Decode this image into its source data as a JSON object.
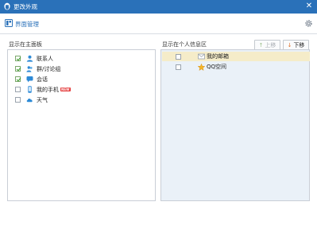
{
  "window": {
    "title": "更改外观",
    "close_glyph": "✕"
  },
  "toolbar": {
    "label": "界面管理"
  },
  "left": {
    "heading": "显示在主面板",
    "items": [
      {
        "label": "联系人",
        "checked": true,
        "icon": "contact-icon"
      },
      {
        "label": "群/讨论组",
        "checked": true,
        "icon": "group-icon"
      },
      {
        "label": "会话",
        "checked": true,
        "icon": "chat-icon"
      },
      {
        "label": "我的手机",
        "checked": false,
        "icon": "phone-icon",
        "badge": "NEW"
      },
      {
        "label": "天气",
        "checked": false,
        "icon": "weather-icon"
      }
    ]
  },
  "right": {
    "heading": "显示在个人信息区",
    "up_label": "上移",
    "down_label": "下移",
    "items": [
      {
        "label": "我的邮箱",
        "checked": false,
        "icon": "mail-icon",
        "selected": true
      },
      {
        "label": "QQ空间",
        "checked": false,
        "icon": "qzone-star-icon",
        "selected": false
      }
    ]
  },
  "colors": {
    "titlebar": "#2a71b9",
    "accent": "#2a71b9",
    "selected_row": "#f5ecc9",
    "right_panel_bg": "#eaf1f8"
  }
}
